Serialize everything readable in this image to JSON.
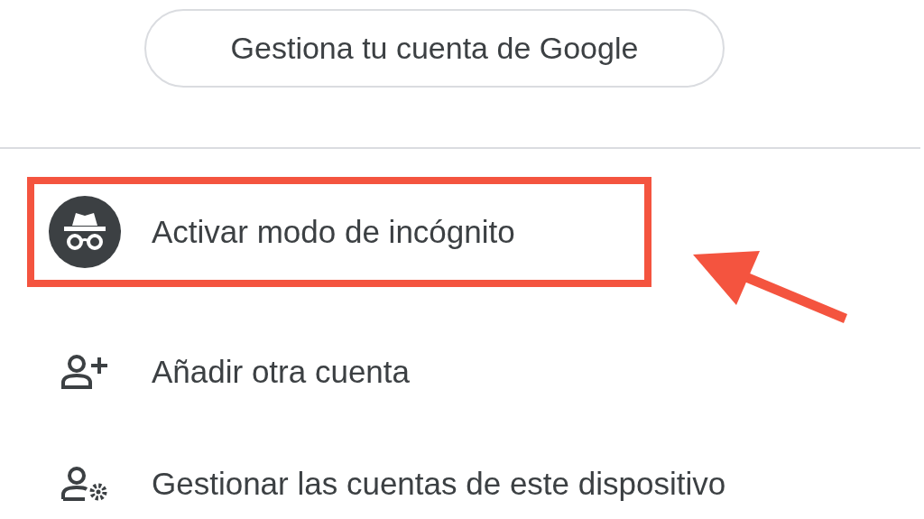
{
  "account_button": {
    "label": "Gestiona tu cuenta de Google"
  },
  "menu_items": [
    {
      "kind": "incognito",
      "label": "Activar modo de incógnito",
      "highlighted": true
    },
    {
      "kind": "add-account",
      "label": "Añadir otra cuenta",
      "highlighted": false
    },
    {
      "kind": "manage-accounts",
      "label": "Gestionar las cuentas de este dispositivo",
      "highlighted": false
    }
  ]
}
